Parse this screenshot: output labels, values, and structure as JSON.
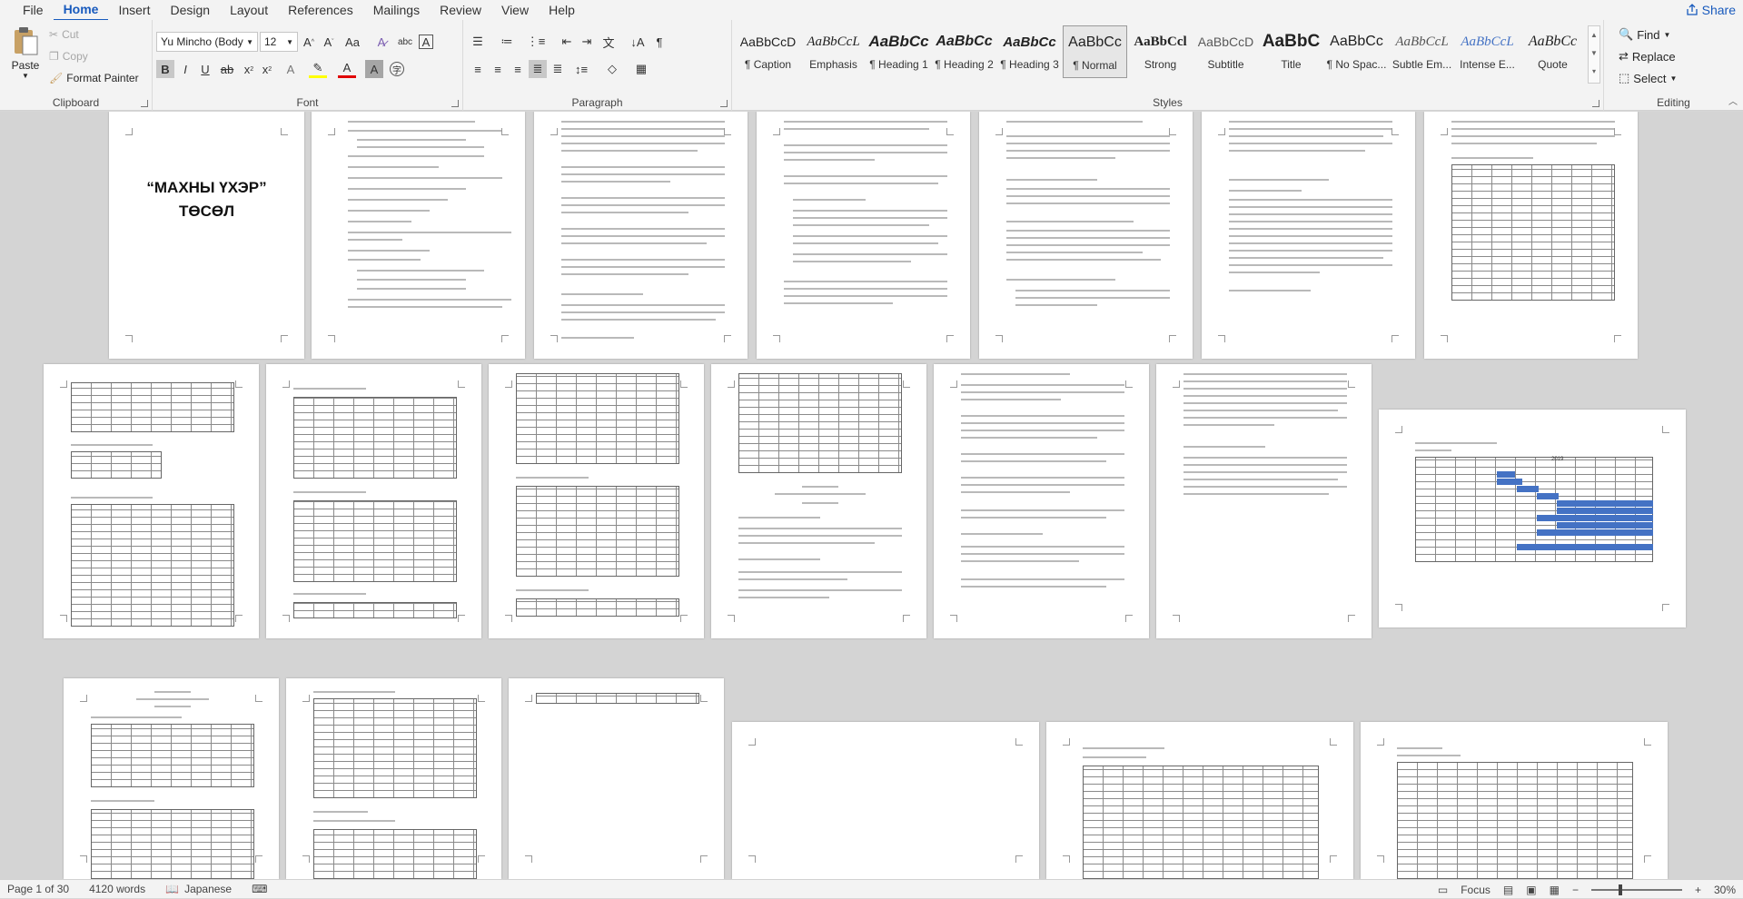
{
  "menubar": {
    "tabs": [
      "File",
      "Home",
      "Insert",
      "Design",
      "Layout",
      "References",
      "Mailings",
      "Review",
      "View",
      "Help"
    ],
    "active": "Home",
    "share": "Share"
  },
  "clipboard": {
    "paste": "Paste",
    "cut": "Cut",
    "copy": "Copy",
    "format_painter": "Format Painter",
    "label": "Clipboard"
  },
  "font": {
    "name": "Yu Mincho (Body",
    "size": "12",
    "label": "Font"
  },
  "paragraph": {
    "label": "Paragraph"
  },
  "styles": {
    "label": "Styles",
    "items": [
      {
        "preview": "AaBbCcD",
        "name": "¶ Caption"
      },
      {
        "preview": "AaBbCcL",
        "name": "Emphasis"
      },
      {
        "preview": "AaBbCc",
        "name": "¶ Heading 1"
      },
      {
        "preview": "AaBbCc",
        "name": "¶ Heading 2"
      },
      {
        "preview": "AaBbCc",
        "name": "¶ Heading 3"
      },
      {
        "preview": "AaBbCc",
        "name": "¶ Normal"
      },
      {
        "preview": "AaBbCcl",
        "name": "Strong"
      },
      {
        "preview": "AaBbCcD",
        "name": "Subtitle"
      },
      {
        "preview": "AaBbC",
        "name": "Title"
      },
      {
        "preview": "AaBbCc",
        "name": "¶ No Spac..."
      },
      {
        "preview": "AaBbCcL",
        "name": "Subtle Em..."
      },
      {
        "preview": "AaBbCcL",
        "name": "Intense E..."
      },
      {
        "preview": "AaBbCc",
        "name": "Quote"
      }
    ]
  },
  "editing": {
    "label": "Editing",
    "find": "Find",
    "replace": "Replace",
    "select": "Select"
  },
  "document": {
    "page1_title_line1": "“МАХНЫ ҮХЭР”",
    "page1_title_line2": "ТӨСӨЛ",
    "chart_year": "2019"
  },
  "status": {
    "page": "Page 1 of 30",
    "words": "4120 words",
    "language": "Japanese",
    "focus": "Focus",
    "zoom": "30%"
  }
}
